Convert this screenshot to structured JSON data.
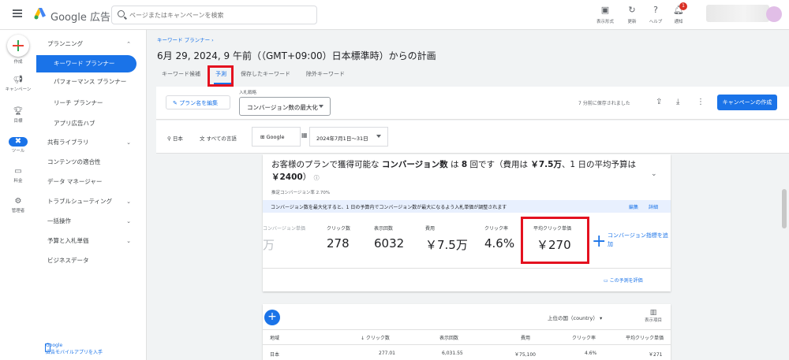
{
  "header": {
    "app_name": "Google 広告",
    "search_placeholder": "ページまたはキャンペーンを検索",
    "tools": [
      {
        "icon": "display-mode-icon",
        "label": "表示形式"
      },
      {
        "icon": "refresh-icon",
        "label": "更新"
      },
      {
        "icon": "help-icon",
        "label": "ヘルプ"
      },
      {
        "icon": "bell-icon",
        "label": "通知"
      }
    ],
    "notification_count": "1"
  },
  "rail": {
    "items": [
      {
        "icon": "plus-icon",
        "label": "作成"
      },
      {
        "icon": "megaphone-icon",
        "label": "キャンペーン"
      },
      {
        "icon": "trophy-icon",
        "label": "目標"
      },
      {
        "icon": "tools-icon",
        "label": "ツール"
      },
      {
        "icon": "billing-icon",
        "label": "料金"
      },
      {
        "icon": "gear-icon",
        "label": "管理者"
      }
    ]
  },
  "sidebar": {
    "items": [
      {
        "label": "プランニング",
        "chevron": "⌃"
      },
      {
        "label": "キーワード プランナー",
        "chevron": ""
      },
      {
        "label": "パフォーマンス プランナー",
        "chevron": ""
      },
      {
        "label": "リーチ プランナー",
        "chevron": ""
      },
      {
        "label": "アプリ広告ハブ",
        "chevron": ""
      },
      {
        "label": "共有ライブラリ",
        "chevron": "⌄"
      },
      {
        "label": "コンテンツの適合性",
        "chevron": ""
      },
      {
        "label": "データ マネージャー",
        "chevron": ""
      },
      {
        "label": "トラブルシューティング",
        "chevron": "⌄"
      },
      {
        "label": "一括操作",
        "chevron": "⌄"
      },
      {
        "label": "予算と入札単価",
        "chevron": "⌄"
      },
      {
        "label": "ビジネスデータ",
        "chevron": ""
      }
    ],
    "mobile_line1": "Google",
    "mobile_line2": "広告モバイルアプリを入手"
  },
  "page": {
    "breadcrumb": "キーワード プランナー ›",
    "title": "6月 29, 2024, 9 午前（（GMT+09:00）日本標準時）からの計画",
    "tabs": [
      "キーワード候補",
      "予測",
      "保存したキーワード",
      "除外キーワード"
    ],
    "edit_plan": "✎ プラン名を編集",
    "bid_label": "入札戦略",
    "bid_value": "コンバージョン数の最大化",
    "saved_text": "7 分前に保存されました",
    "create_campaign": "キャンペーンの作成",
    "location": "日本",
    "language": "すべての言語",
    "network": "Google",
    "date_range": "2024年7月1日～31日"
  },
  "forecast": {
    "headline_pre": "お客様のプランで獲得可能な ",
    "headline_bold1": "コンバージョン数",
    "headline_mid": " は ",
    "headline_bold2": "8",
    "headline_mid2": " 回です（費用は ",
    "headline_bold3": "￥7.5万",
    "headline_mid3": "、1 日の平均予算は ",
    "headline_bold4": "￥2400",
    "headline_post": "）",
    "sub": "推定コンバージョン率 2.70%",
    "banner": "コンバージョン数を最大化すると、1 日の予算内でコンバージョン数が最大になるよう入札単価が調整されます",
    "banner_link1": "編集",
    "banner_link2": "詳細",
    "metrics": [
      {
        "label": "コンバージョン単価",
        "value": "万"
      },
      {
        "label": "クリック数",
        "value": "278"
      },
      {
        "label": "表示回数",
        "value": "6032"
      },
      {
        "label": "費用",
        "value": "￥7.5万"
      },
      {
        "label": "クリック率",
        "value": "4.6%"
      },
      {
        "label": "平均クリック単価",
        "value": "￥270"
      }
    ],
    "add_metric": "コンバージョン指標を追加",
    "rate_link": "この予測を評価"
  },
  "table": {
    "group_select": "上位の国（country）",
    "columns_label": "表示項目",
    "headers": [
      "地域",
      "↓ クリック数",
      "表示回数",
      "費用",
      "クリック率",
      "平均クリック単価"
    ],
    "row": [
      "日本",
      "277.01",
      "6,031.55",
      "￥75,100",
      "4.6%",
      "￥271"
    ]
  }
}
